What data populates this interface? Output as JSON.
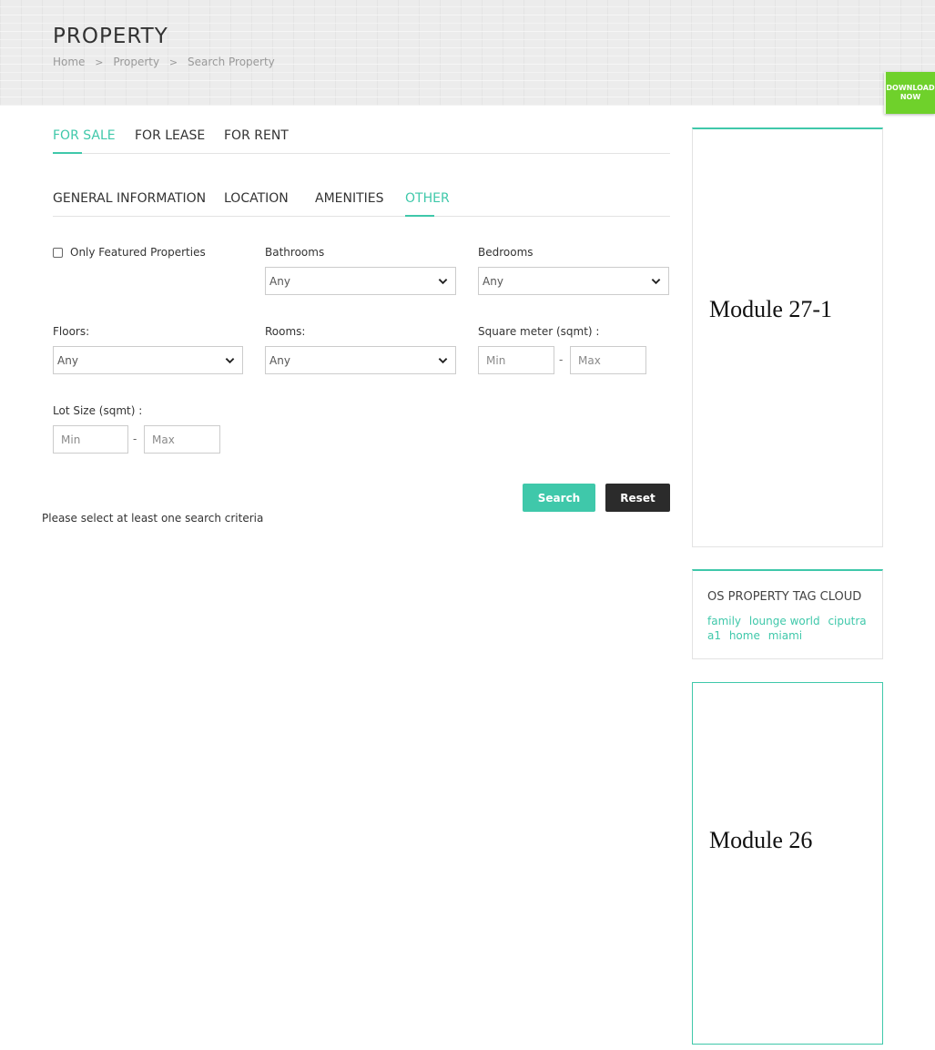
{
  "header": {
    "title": "PROPERTY",
    "breadcrumb": [
      "Home",
      "Property",
      "Search Property"
    ],
    "breadcrumb_separator": ">",
    "download_badge": [
      "DOWNLOAD",
      "NOW"
    ]
  },
  "listing_tabs": [
    {
      "label": "FOR SALE",
      "active": true
    },
    {
      "label": "FOR LEASE",
      "active": false
    },
    {
      "label": "FOR RENT",
      "active": false
    }
  ],
  "section_tabs": [
    {
      "label": "GENERAL INFORMATION",
      "active": false
    },
    {
      "label": "LOCATION",
      "active": false
    },
    {
      "label": "AMENITIES",
      "active": false
    },
    {
      "label": "OTHER",
      "active": true
    }
  ],
  "form": {
    "featured_label": "Only Featured Properties",
    "featured_checked": false,
    "bathrooms": {
      "label": "Bathrooms",
      "value": "Any"
    },
    "bedrooms": {
      "label": "Bedrooms",
      "value": "Any"
    },
    "floors": {
      "label": "Floors:",
      "value": "Any"
    },
    "rooms": {
      "label": "Rooms:",
      "value": "Any"
    },
    "square_meter": {
      "label": "Square meter (sqmt) :",
      "min_placeholder": "Min",
      "max_placeholder": "Max",
      "separator": "-"
    },
    "lot_size": {
      "label": "Lot Size (sqmt) :",
      "min_placeholder": "Min",
      "max_placeholder": "Max",
      "separator": "-"
    },
    "search_label": "Search",
    "reset_label": "Reset",
    "message": "Please select at least one search criteria"
  },
  "sidebar": {
    "module_27_title": "Module 27-1",
    "tag_cloud": {
      "title": "OS PROPERTY TAG CLOUD",
      "tags": [
        "family",
        "lounge world",
        "ciputra",
        "a1",
        "home",
        "miami"
      ]
    },
    "module_26_title": "Module 26"
  },
  "colors": {
    "accent": "#3fc8aa",
    "dark_button": "#2b2b2b",
    "download_badge": "#6fd12b"
  }
}
